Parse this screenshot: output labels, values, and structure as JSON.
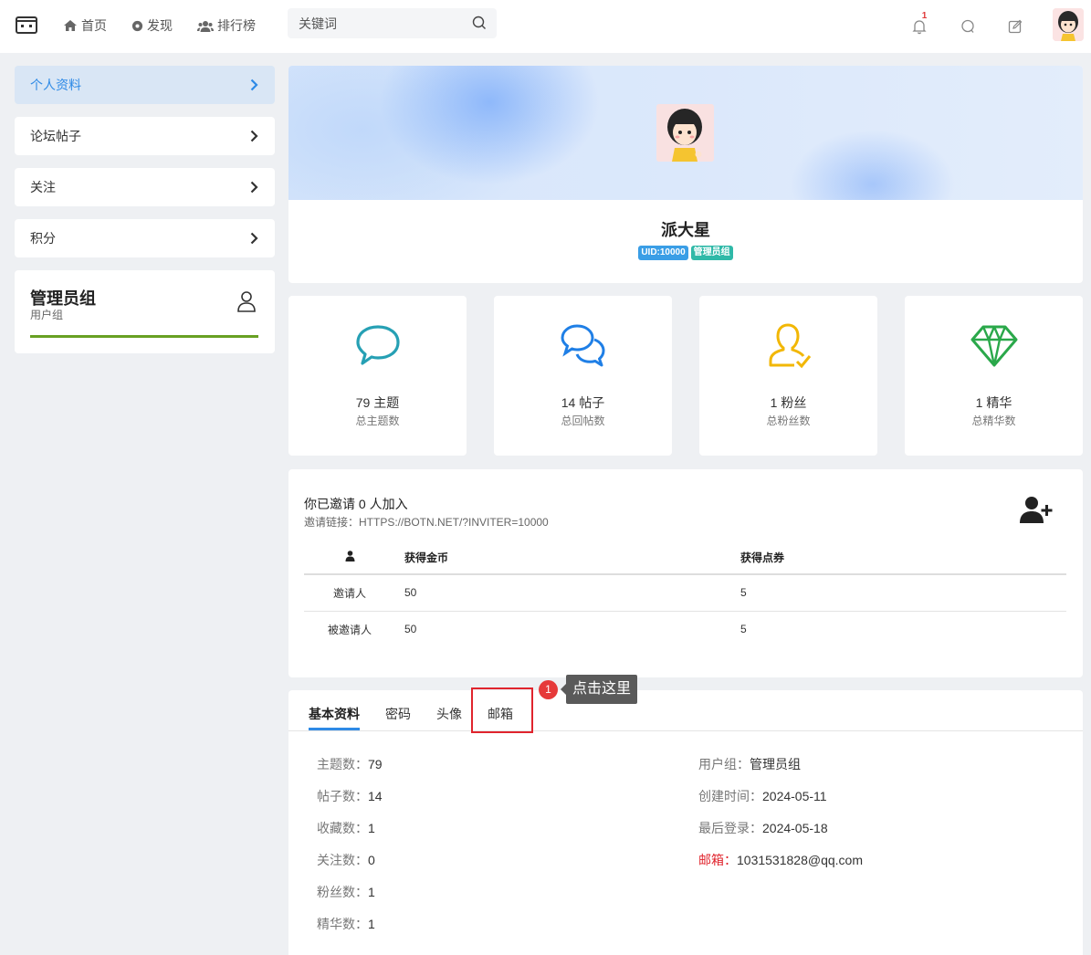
{
  "header": {
    "nav": [
      {
        "label": "首页",
        "icon": "home-icon"
      },
      {
        "label": "发现",
        "icon": "compass-icon"
      },
      {
        "label": "排行榜",
        "icon": "users-icon"
      }
    ],
    "search_placeholder": "关键词",
    "notification_count": "1"
  },
  "sidebar": {
    "items": [
      {
        "label": "个人资料"
      },
      {
        "label": "论坛帖子"
      },
      {
        "label": "关注"
      },
      {
        "label": "积分"
      }
    ],
    "group": {
      "title": "管理员组",
      "subtitle": "用户组"
    }
  },
  "profile": {
    "name": "派大星",
    "uid_badge": "UID:10000",
    "group_badge": "管理员组"
  },
  "stats": [
    {
      "value": "79 主题",
      "label": "总主题数",
      "color": "#26a0b4"
    },
    {
      "value": "14 帖子",
      "label": "总回帖数",
      "color": "#1f7fe6"
    },
    {
      "value": "1 粉丝",
      "label": "总粉丝数",
      "color": "#f2b705"
    },
    {
      "value": "1 精华",
      "label": "总精华数",
      "color": "#2aa84a"
    }
  ],
  "invite": {
    "title": "你已邀请 0 人加入",
    "link": "邀请链接：HTTPS://BOTN.NET/?INVITER=10000",
    "table": {
      "headers": [
        "获得金币",
        "获得点券"
      ],
      "rows": [
        [
          "邀请人",
          "50",
          "5"
        ],
        [
          "被邀请人",
          "50",
          "5"
        ]
      ]
    }
  },
  "tabs": [
    "基本资料",
    "密码",
    "头像",
    "邮箱"
  ],
  "annotation": {
    "step": "1",
    "tooltip": "点击这里"
  },
  "details": {
    "left": [
      {
        "key": "主题数：",
        "value": "79"
      },
      {
        "key": "帖子数：",
        "value": "14"
      },
      {
        "key": "收藏数：",
        "value": "1"
      },
      {
        "key": "关注数：",
        "value": "0"
      },
      {
        "key": "粉丝数：",
        "value": "1"
      },
      {
        "key": "精华数：",
        "value": "1"
      }
    ],
    "right": [
      {
        "key": "用户组：",
        "value": "管理员组"
      },
      {
        "key": "创建时间：",
        "value": "2024-05-11"
      },
      {
        "key": "最后登录：",
        "value": "2024-05-18"
      },
      {
        "key": "邮箱：",
        "value": "1031531828@qq.com"
      }
    ]
  }
}
